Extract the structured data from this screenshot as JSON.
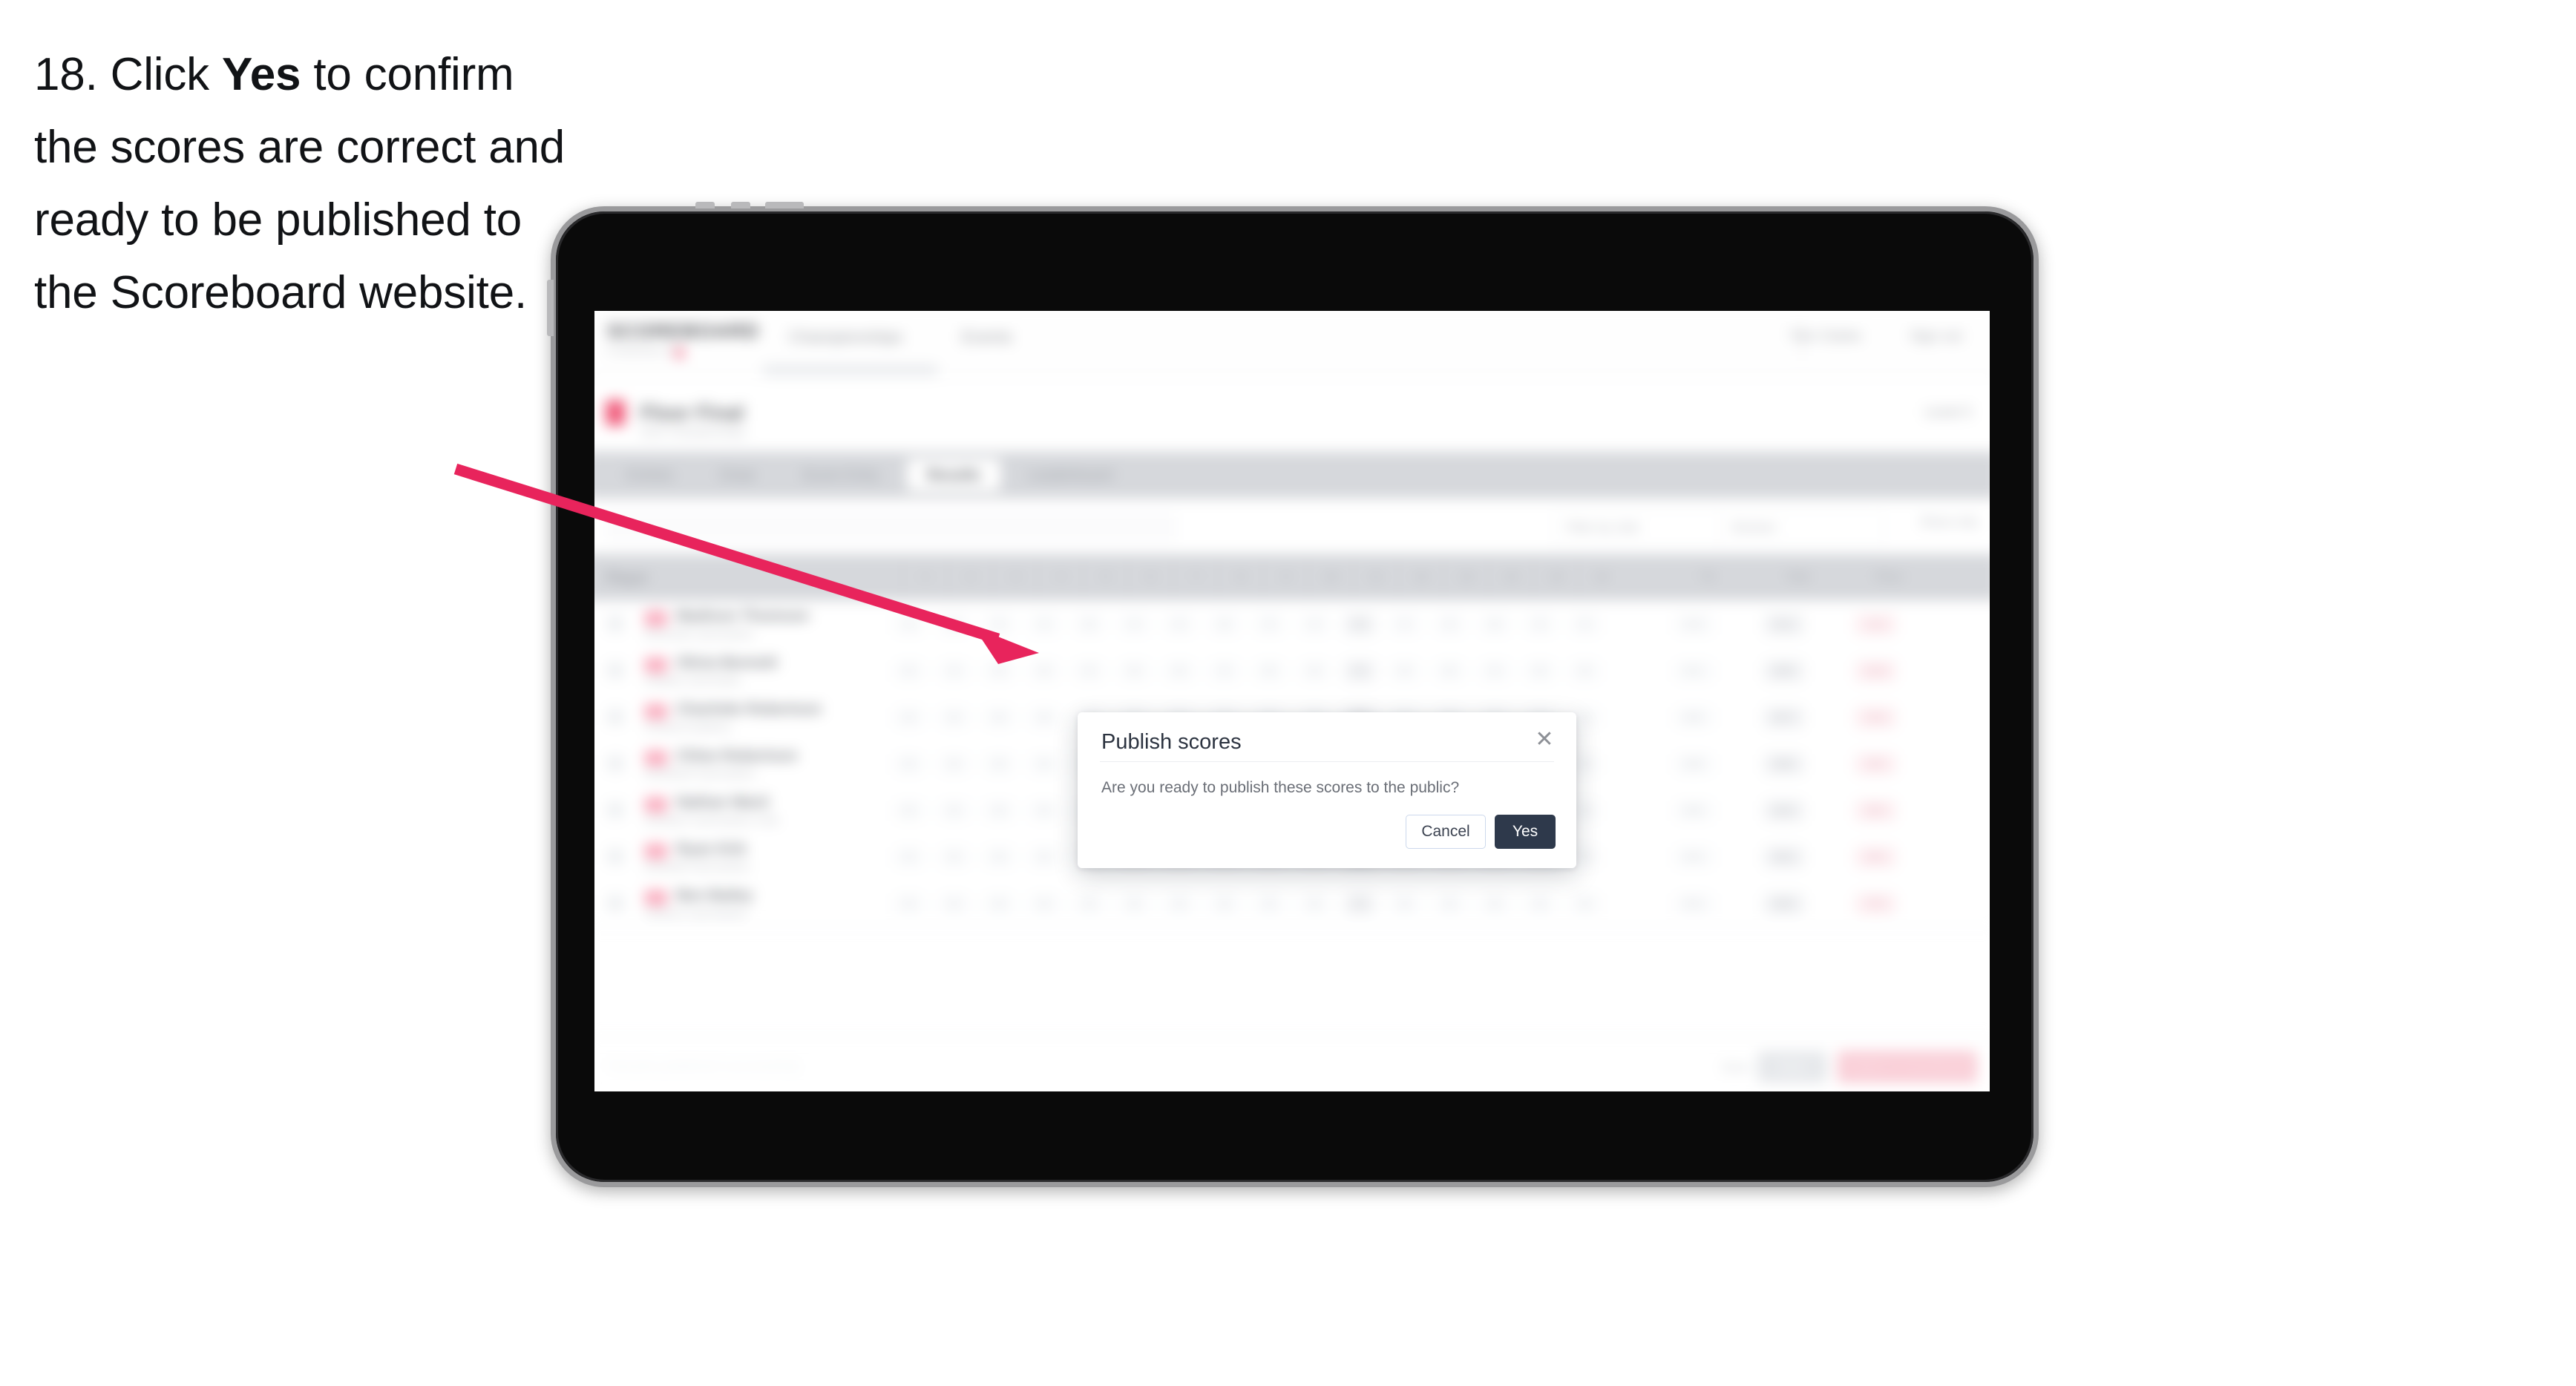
{
  "instruction": {
    "number": "18.",
    "before": "Click",
    "emphasis": "Yes",
    "after": "to confirm the scores are correct and ready to be published to the Scoreboard website."
  },
  "annotation": {
    "arrow_color": "#e8245c",
    "points_to": "yes-button"
  },
  "device": {
    "type": "tablet",
    "frame_color": "#9a9a9c",
    "bezel_color": "#0a0a0a"
  },
  "app": {
    "topnav": {
      "brand": "SCOREBOARD",
      "brand_sub": "POWERED BY",
      "links": [
        "Championships",
        "Events"
      ],
      "right_links": [
        "Tom Clarke",
        "Sign out"
      ]
    },
    "event_header": {
      "title": "Floor Final",
      "subtitle": "2024 Championships",
      "right": "Level 3"
    },
    "tabs": [
      {
        "label": "Entries",
        "active": false
      },
      {
        "label": "Draw",
        "active": false
      },
      {
        "label": "Score Entry",
        "active": false
      },
      {
        "label": "Results",
        "active": true
      },
      {
        "label": "Leaderboard",
        "active": false
      }
    ],
    "filters": {
      "search_placeholder": "Search players",
      "selects": [
        "Filter by club",
        "Division"
      ],
      "toggle_label": "Show only"
    },
    "table": {
      "columns": [
        "Player",
        "1",
        "2",
        "3",
        "4",
        "5",
        "6",
        "7",
        "8",
        "9",
        "10",
        "11",
        "12",
        "13",
        "14",
        "15",
        "16",
        "TD",
        "Total",
        "Place"
      ],
      "rows": [
        {
          "name": "Madison Thomson",
          "club": "Riverside Gymnastics",
          "scores": [
            "9",
            "8",
            "9",
            "9",
            "8",
            "9",
            "9",
            "8",
            "9",
            "9",
            "8",
            "9",
            "9",
            "8",
            "9",
            "9"
          ],
          "td": "9.3",
          "total": "9.1",
          "place": "1st"
        },
        {
          "name": "Olivia Bennett",
          "club": "Hawkes Gymnastic",
          "scores": [
            "8",
            "9",
            "8",
            "8",
            "9",
            "8",
            "8",
            "9",
            "8",
            "8",
            "9",
            "8",
            "8",
            "9",
            "8",
            "8"
          ],
          "td": "9.1",
          "total": "8.9",
          "place": "2nd"
        },
        {
          "name": "Charlotte Robertson",
          "club": "Central Academy",
          "scores": [
            "8",
            "8",
            "8",
            "8",
            "8",
            "8",
            "8",
            "8",
            "8",
            "8",
            "8",
            "8",
            "8",
            "8",
            "8",
            "8"
          ],
          "td": "8.9",
          "total": "8.7",
          "place": "3rd"
        },
        {
          "name": "Chloe Robertson",
          "club": "Northland Gymnastics",
          "scores": [
            "8",
            "8",
            "8",
            "8",
            "8",
            "8",
            "8",
            "8",
            "8",
            "8",
            "8",
            "8",
            "8",
            "8",
            "8",
            "8"
          ],
          "td": "8.8",
          "total": "8.6",
          "place": "4th"
        },
        {
          "name": "Nathan Ward",
          "club": "Southern Gymnastics Club",
          "scores": [
            "8",
            "8",
            "8",
            "8",
            "8",
            "8",
            "8",
            "8",
            "8",
            "8",
            "8",
            "8",
            "8",
            "8",
            "8",
            "8"
          ],
          "td": "8.6",
          "total": "8.4",
          "place": "5th"
        },
        {
          "name": "Ryan Kirk",
          "club": "Eastside Gymnastics",
          "scores": [
            "8",
            "8",
            "8",
            "8",
            "8",
            "8",
            "8",
            "8",
            "8",
            "8",
            "8",
            "8",
            "8",
            "8",
            "8",
            "8"
          ],
          "td": "8.4",
          "total": "8.2",
          "place": "6th"
        },
        {
          "name": "Ben Bailey",
          "club": "Harbour Gymnastics",
          "scores": [
            "8",
            "8",
            "8",
            "8",
            "8",
            "8",
            "8",
            "8",
            "8",
            "8",
            "8",
            "8",
            "8",
            "8",
            "8",
            "8"
          ],
          "td": "8.2",
          "total": "8.0",
          "place": "7th"
        }
      ]
    },
    "action_bar": {
      "status": "Results published successfully",
      "note": "Save",
      "secondary_button": "Save",
      "primary_button": "Publish to Scoreboard"
    }
  },
  "modal": {
    "title": "Publish scores",
    "body": "Are you ready to publish these scores to the public?",
    "close_icon": "close-icon",
    "cancel_label": "Cancel",
    "confirm_label": "Yes",
    "confirm_bg": "#2e394b",
    "cancel_border": "#cdd9ec"
  }
}
